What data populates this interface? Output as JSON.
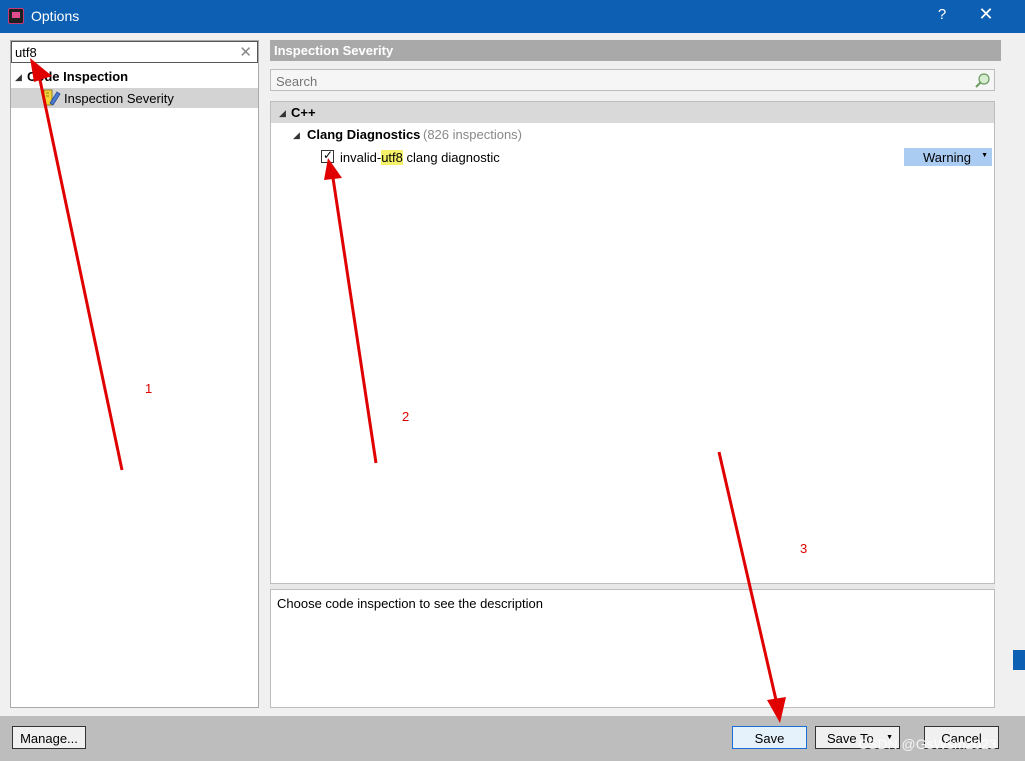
{
  "window": {
    "title": "Options",
    "help_label": "?",
    "close_label": "✕"
  },
  "sidebar": {
    "filter_value": "utf8",
    "clear_label": "✕",
    "tree": [
      {
        "label": "Code Inspection"
      },
      {
        "label": "Inspection Severity"
      }
    ]
  },
  "main": {
    "section_title": "Inspection Severity",
    "search_placeholder": "Search",
    "group_label": "C++",
    "subgroup_label": "Clang Diagnostics",
    "subgroup_count": "(826 inspections)",
    "item": {
      "checked": true,
      "label_prefix": "invalid-",
      "label_highlight": "utf8",
      "label_suffix": " clang diagnostic",
      "severity": "Warning"
    },
    "description": "Choose code inspection to see the description"
  },
  "footer": {
    "manage_label": "Manage...",
    "save_label": "Save",
    "save_to_label": "Save To",
    "cancel_label": "Cancel"
  },
  "annotations": {
    "one": "1",
    "two": "2",
    "three": "3"
  },
  "watermark": "CSDN @GsWsm2023",
  "colors": {
    "titlebar": "#0c5fb2",
    "highlight": "#f5f26a",
    "severity_bg": "#aacbf2",
    "arrow": "#e00000"
  }
}
